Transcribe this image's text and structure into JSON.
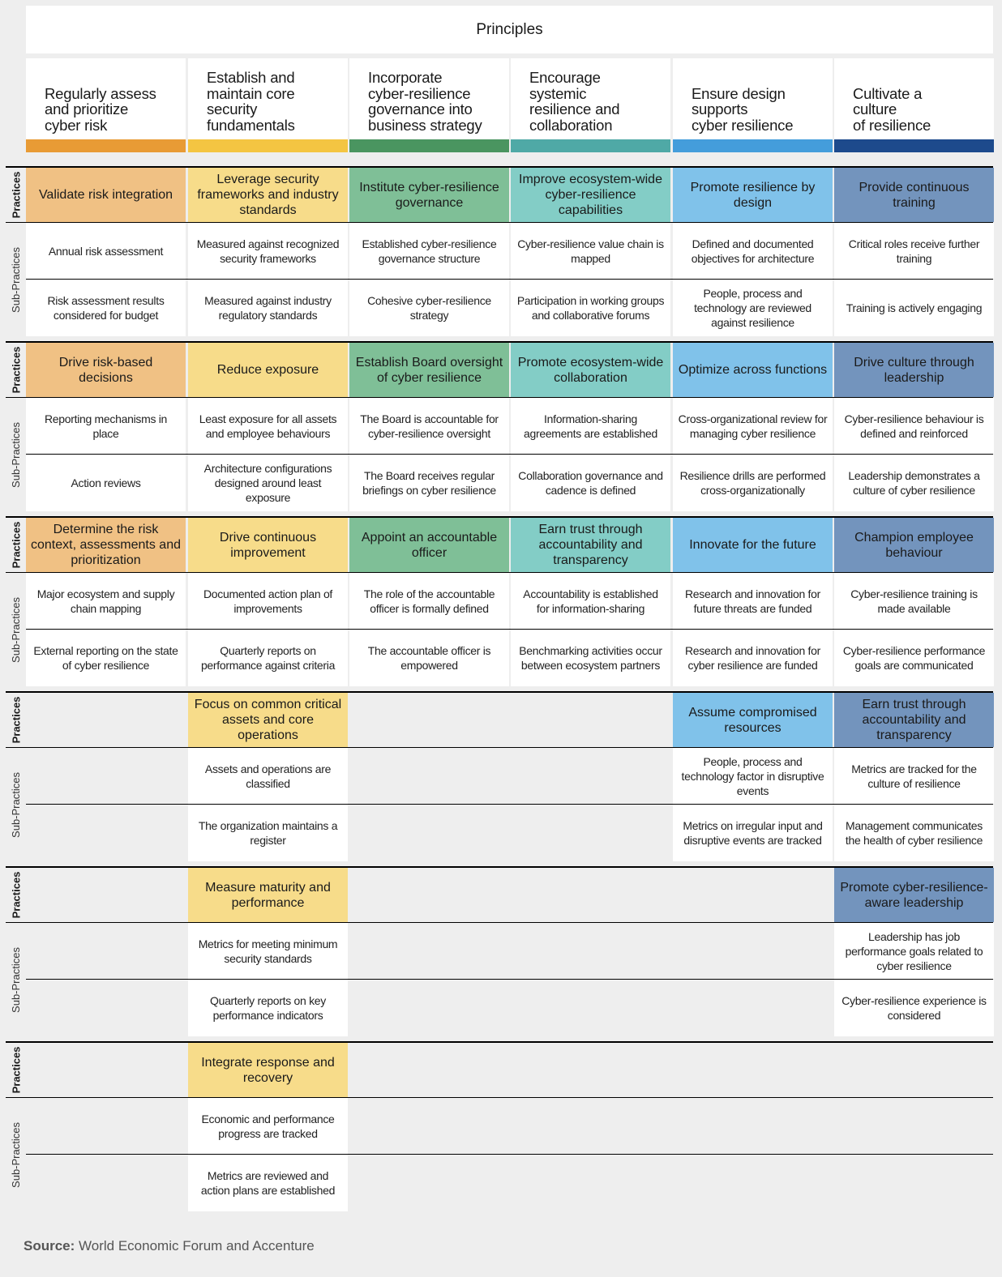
{
  "title": "Principles",
  "row_labels": {
    "practices": "Practices",
    "sub_practices": "Sub-Practices"
  },
  "principles": [
    {
      "label": "Regularly assess and prioritize cyber risk",
      "lines": [
        "Regularly assess",
        "and prioritize",
        "cyber risk"
      ],
      "bar_color": "#e89b35",
      "practice_color": "#f0c184"
    },
    {
      "label": "Establish and maintain core security fundamentals",
      "lines": [
        "Establish and",
        "maintain core",
        "security",
        "fundamentals"
      ],
      "bar_color": "#f4c542",
      "practice_color": "#f7dc8a"
    },
    {
      "label": "Incorporate cyber-resilience governance into business strategy",
      "lines": [
        "Incorporate",
        "cyber-resilience",
        "governance into",
        "business strategy"
      ],
      "bar_color": "#4a9560",
      "practice_color": "#7fbf97"
    },
    {
      "label": "Encourage systemic resilience and collaboration",
      "lines": [
        "Encourage",
        "systemic",
        "resilience and",
        "collaboration"
      ],
      "bar_color": "#4fa9a6",
      "practice_color": "#83cdc6"
    },
    {
      "label": "Ensure design supports cyber resilience",
      "lines": [
        "Ensure design",
        "supports",
        "cyber resilience"
      ],
      "bar_color": "#449ddb",
      "practice_color": "#80c2ea"
    },
    {
      "label": "Cultivate a culture of resilience",
      "lines": [
        "Cultivate a",
        "culture",
        "of resilience"
      ],
      "bar_color": "#1d4a8c",
      "practice_color": "#7394bd"
    }
  ],
  "sections": [
    {
      "cells": [
        {
          "col": 0,
          "practice": "Validate risk integration",
          "subs": [
            "Annual risk assessment",
            "Risk assessment results considered for budget"
          ]
        },
        {
          "col": 1,
          "practice": "Leverage security frameworks and industry standards",
          "subs": [
            "Measured against recognized security frameworks",
            "Measured against industry regulatory standards"
          ]
        },
        {
          "col": 2,
          "practice": "Institute cyber-resilience governance",
          "subs": [
            "Established cyber-resilience governance structure",
            "Cohesive cyber-resilience strategy"
          ]
        },
        {
          "col": 3,
          "practice": "Improve ecosystem-wide cyber-resilience capabilities",
          "subs": [
            "Cyber-resilience value chain is mapped",
            "Participation in working groups and collaborative forums"
          ]
        },
        {
          "col": 4,
          "practice": "Promote resilience by design",
          "subs": [
            "Defined and documented objectives for architecture",
            "People, process and technology are reviewed against resilience"
          ]
        },
        {
          "col": 5,
          "practice": "Provide continuous training",
          "subs": [
            "Critical roles receive further training",
            "Training is actively engaging"
          ]
        }
      ]
    },
    {
      "cells": [
        {
          "col": 0,
          "practice": "Drive risk-based decisions",
          "subs": [
            "Reporting mechanisms in place",
            "Action reviews"
          ]
        },
        {
          "col": 1,
          "practice": "Reduce exposure",
          "subs": [
            "Least exposure for all assets and employee behaviours",
            "Architecture configurations designed around least exposure"
          ]
        },
        {
          "col": 2,
          "practice": "Establish Board oversight of cyber resilience",
          "subs": [
            "The Board is accountable for cyber-resilience oversight",
            "The Board receives regular briefings on cyber resilience"
          ]
        },
        {
          "col": 3,
          "practice": "Promote ecosystem-wide collaboration",
          "subs": [
            "Information-sharing agreements are established",
            "Collaboration governance and cadence is defined"
          ]
        },
        {
          "col": 4,
          "practice": "Optimize across functions",
          "subs": [
            "Cross-organizational review for managing cyber resilience",
            "Resilience drills are performed cross-organizationally"
          ]
        },
        {
          "col": 5,
          "practice": "Drive culture through leadership",
          "subs": [
            "Cyber-resilience behaviour is defined and reinforced",
            "Leadership demonstrates a culture of cyber resilience"
          ]
        }
      ]
    },
    {
      "cells": [
        {
          "col": 0,
          "practice": "Determine the risk context, assessments and prioritization",
          "subs": [
            "Major ecosystem and supply chain mapping",
            "External reporting on the state of cyber resilience"
          ]
        },
        {
          "col": 1,
          "practice": "Drive continuous improvement",
          "subs": [
            "Documented action plan of improvements",
            "Quarterly reports on performance against criteria"
          ]
        },
        {
          "col": 2,
          "practice": "Appoint an accountable officer",
          "subs": [
            "The role of the accountable officer is formally defined",
            "The accountable officer is empowered"
          ]
        },
        {
          "col": 3,
          "practice": "Earn trust through accountability and transparency",
          "subs": [
            "Accountability is established for information-sharing",
            "Benchmarking activities occur between ecosystem partners"
          ]
        },
        {
          "col": 4,
          "practice": "Innovate for the future",
          "subs": [
            "Research and innovation for future threats are funded",
            "Research and innovation for cyber resilience are funded"
          ]
        },
        {
          "col": 5,
          "practice": "Champion employee behaviour",
          "subs": [
            "Cyber-resilience training is made available",
            "Cyber-resilience performance goals are communicated"
          ]
        }
      ]
    },
    {
      "cells": [
        {
          "col": 1,
          "practice": "Focus on common critical assets and core operations",
          "subs": [
            "Assets and operations are classified",
            "The organization maintains a register"
          ]
        },
        {
          "col": 4,
          "practice": "Assume compromised resources",
          "subs": [
            "People, process and technology factor in disruptive events",
            "Metrics on irregular input and disruptive events are tracked"
          ]
        },
        {
          "col": 5,
          "practice": "Earn trust through accountability and transparency",
          "subs": [
            "Metrics are tracked for the culture of resilience",
            "Management communicates the health of cyber resilience"
          ]
        }
      ]
    },
    {
      "cells": [
        {
          "col": 1,
          "practice": "Measure maturity and performance",
          "subs": [
            "Metrics for meeting minimum security standards",
            "Quarterly reports on key performance indicators"
          ]
        },
        {
          "col": 5,
          "practice": "Promote cyber-resilience-aware leadership",
          "subs": [
            "Leadership has job performance goals related to cyber resilience",
            "Cyber-resilience experience is considered"
          ]
        }
      ]
    },
    {
      "cells": [
        {
          "col": 1,
          "practice": "Integrate response and recovery",
          "subs": [
            "Economic and performance progress are tracked",
            "Metrics are reviewed and action plans are established"
          ]
        }
      ]
    }
  ],
  "source": {
    "label": "Source:",
    "text": "World Economic Forum and Accenture"
  }
}
